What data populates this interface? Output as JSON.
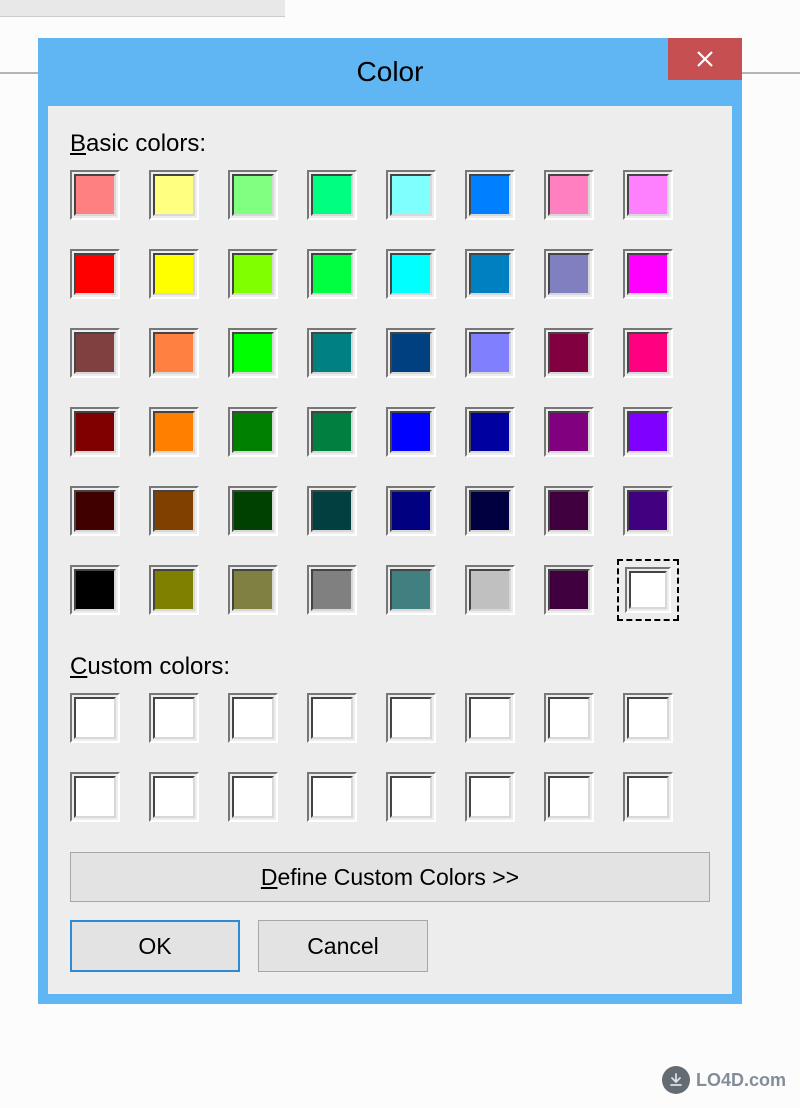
{
  "dialog": {
    "title": "Color",
    "basic_label_u": "B",
    "basic_label_rest": "asic colors:",
    "custom_label_u": "C",
    "custom_label_rest": "ustom colors:",
    "define_label_u": "D",
    "define_label_rest": "efine Custom Colors >>",
    "ok_label": "OK",
    "cancel_label": "Cancel"
  },
  "basic_colors": [
    "#ff8080",
    "#ffff80",
    "#80ff80",
    "#00ff80",
    "#80ffff",
    "#0080ff",
    "#ff80c0",
    "#ff80ff",
    "#ff0000",
    "#ffff00",
    "#80ff00",
    "#00ff40",
    "#00ffff",
    "#0080c0",
    "#8080c0",
    "#ff00ff",
    "#804040",
    "#ff8040",
    "#00ff00",
    "#008080",
    "#004080",
    "#8080ff",
    "#800040",
    "#ff0080",
    "#800000",
    "#ff8000",
    "#008000",
    "#008040",
    "#0000ff",
    "#0000a0",
    "#800080",
    "#8000ff",
    "#400000",
    "#804000",
    "#004000",
    "#004040",
    "#000080",
    "#000040",
    "#400040",
    "#400080",
    "#000000",
    "#808000",
    "#808040",
    "#808080",
    "#408080",
    "#c0c0c0",
    "#400040",
    "#ffffff"
  ],
  "selected_index": 47,
  "custom_colors": [
    "#ffffff",
    "#ffffff",
    "#ffffff",
    "#ffffff",
    "#ffffff",
    "#ffffff",
    "#ffffff",
    "#ffffff",
    "#ffffff",
    "#ffffff",
    "#ffffff",
    "#ffffff",
    "#ffffff",
    "#ffffff",
    "#ffffff",
    "#ffffff"
  ],
  "watermark": "LO4D.com"
}
